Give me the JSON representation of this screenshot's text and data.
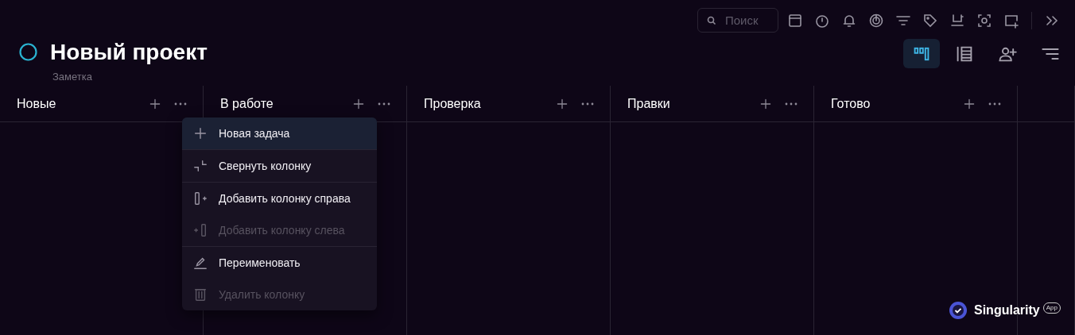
{
  "search": {
    "placeholder": "Поиск"
  },
  "views": [
    {
      "selected": true
    },
    {
      "selected": false
    },
    {
      "selected": false
    },
    {
      "selected": false
    }
  ],
  "project": {
    "title": "Новый проект",
    "subtitle": "Заметка"
  },
  "columns": [
    {
      "title": "Новые"
    },
    {
      "title": "В работе"
    },
    {
      "title": "Проверка"
    },
    {
      "title": "Правки"
    },
    {
      "title": "Готово"
    }
  ],
  "menu": {
    "groups": [
      [
        {
          "label": "Новая задача",
          "disabled": false,
          "selected": true
        }
      ],
      [
        {
          "label": "Свернуть колонку",
          "disabled": false,
          "selected": false
        }
      ],
      [
        {
          "label": "Добавить колонку справа",
          "disabled": false,
          "selected": false
        },
        {
          "label": "Добавить колонку слева",
          "disabled": true,
          "selected": false
        }
      ],
      [
        {
          "label": "Переименовать",
          "disabled": false,
          "selected": false
        },
        {
          "label": "Удалить колонку",
          "disabled": true,
          "selected": false
        }
      ]
    ]
  },
  "brand": {
    "name": "Singularity",
    "tag": "App"
  }
}
